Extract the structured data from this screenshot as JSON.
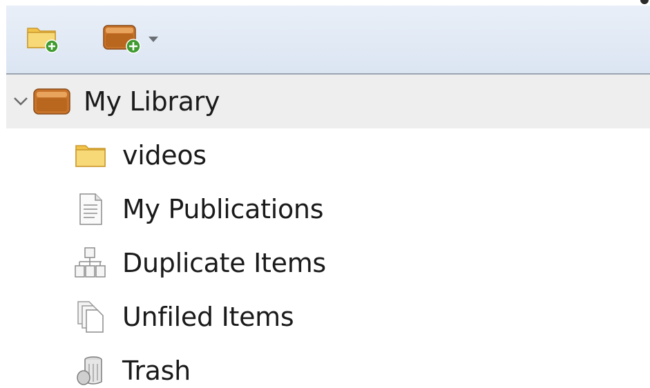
{
  "toolbar": {
    "buttons": [
      {
        "name": "new-collection",
        "icon": "folder-add-icon"
      },
      {
        "name": "new-library",
        "icon": "library-add-icon",
        "has_dropdown": true
      }
    ]
  },
  "tree": {
    "root": {
      "label": "My Library",
      "icon": "library-icon",
      "expanded": true,
      "selected": true
    },
    "children": [
      {
        "label": "videos",
        "icon": "folder-icon"
      },
      {
        "label": "My Publications",
        "icon": "document-icon"
      },
      {
        "label": "Duplicate Items",
        "icon": "duplicate-icon"
      },
      {
        "label": "Unfiled Items",
        "icon": "unfiled-icon"
      },
      {
        "label": "Trash",
        "icon": "trash-icon"
      }
    ]
  },
  "colors": {
    "toolbar_bg_top": "#e9eff8",
    "toolbar_bg_bottom": "#dbe5f2",
    "selected_row": "#eeeeee",
    "folder_yellow": "#f3c94f",
    "library_brown": "#c8732a"
  }
}
